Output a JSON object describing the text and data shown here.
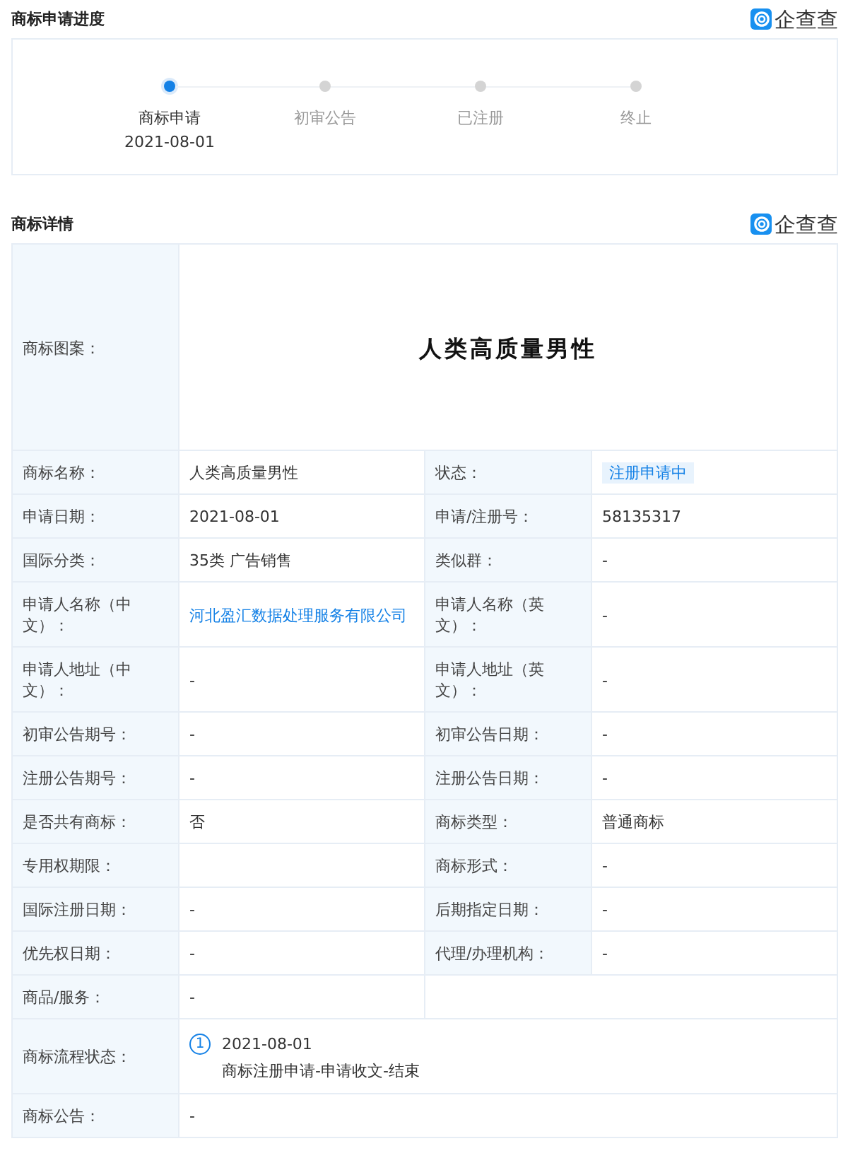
{
  "progress": {
    "title": "商标申请进度",
    "logo": "企查查",
    "steps": [
      {
        "label": "商标申请",
        "date": "2021-08-01",
        "selected": true
      },
      {
        "label": "初审公告",
        "selected": false
      },
      {
        "label": "已注册",
        "selected": false
      },
      {
        "label": "终止",
        "selected": false
      }
    ]
  },
  "details": {
    "title": "商标详情",
    "logo": "企查查",
    "rows": [
      {
        "kind": "pattern",
        "label": "商标图案：",
        "value": "人类高质量男性"
      },
      {
        "kind": "pair",
        "items": [
          {
            "label": "商标名称：",
            "value": "人类高质量男性",
            "kind": "text"
          },
          {
            "label": "状态：",
            "value": "注册申请中",
            "kind": "tag"
          }
        ]
      },
      {
        "kind": "pair",
        "items": [
          {
            "label": "申请日期：",
            "value": "2021-08-01",
            "kind": "text"
          },
          {
            "label": "申请/注册号：",
            "value": "58135317",
            "kind": "text"
          }
        ]
      },
      {
        "kind": "pair",
        "items": [
          {
            "label": "国际分类：",
            "value": "35类 广告销售",
            "kind": "text"
          },
          {
            "label": "类似群：",
            "value": "-",
            "kind": "text"
          }
        ]
      },
      {
        "kind": "pair",
        "items": [
          {
            "label": "申请人名称（中文）：",
            "value": "河北盈汇数据处理服务有限公司",
            "kind": "link"
          },
          {
            "label": "申请人名称（英文）：",
            "value": "-",
            "kind": "text"
          }
        ]
      },
      {
        "kind": "pair",
        "items": [
          {
            "label": "申请人地址（中文）：",
            "value": "-",
            "kind": "text"
          },
          {
            "label": "申请人地址（英文）：",
            "value": "-",
            "kind": "text"
          }
        ]
      },
      {
        "kind": "pair",
        "items": [
          {
            "label": "初审公告期号：",
            "value": "-",
            "kind": "text"
          },
          {
            "label": "初审公告日期：",
            "value": "-",
            "kind": "text"
          }
        ]
      },
      {
        "kind": "pair",
        "items": [
          {
            "label": "注册公告期号：",
            "value": "-",
            "kind": "text"
          },
          {
            "label": "注册公告日期：",
            "value": "-",
            "kind": "text"
          }
        ]
      },
      {
        "kind": "pair",
        "items": [
          {
            "label": "是否共有商标：",
            "value": "否",
            "kind": "text"
          },
          {
            "label": "商标类型：",
            "value": "普通商标",
            "kind": "text"
          }
        ]
      },
      {
        "kind": "pair",
        "items": [
          {
            "label": "专用权期限："
          },
          {
            "label": "商标形式：",
            "value": "-",
            "kind": "text"
          }
        ]
      },
      {
        "kind": "pair",
        "items": [
          {
            "label": "国际注册日期：",
            "value": "-",
            "kind": "text"
          },
          {
            "label": "后期指定日期：",
            "value": "-",
            "kind": "text"
          }
        ]
      },
      {
        "kind": "pair",
        "items": [
          {
            "label": "优先权日期：",
            "value": "-",
            "kind": "text"
          },
          {
            "label": "代理/办理机构：",
            "value": "-",
            "kind": "text"
          }
        ]
      },
      {
        "kind": "single",
        "label": "商品/服务：",
        "value": "-"
      },
      {
        "kind": "flow",
        "label": "商标流程状态：",
        "entries": [
          {
            "index": "1",
            "date": "2021-08-01",
            "text": "商标注册申请-申请收文-结束"
          }
        ]
      },
      {
        "kind": "wide",
        "label": "商标公告：",
        "value": "-"
      }
    ]
  }
}
